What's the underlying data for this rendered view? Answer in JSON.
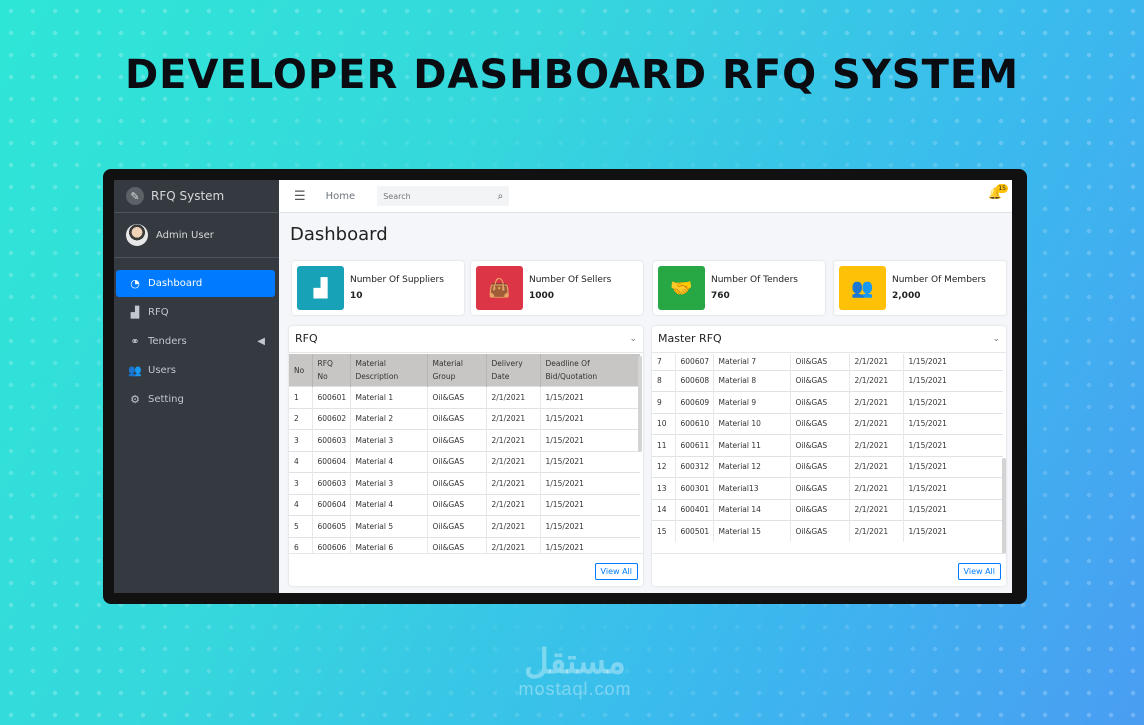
{
  "headline": "DEVELOPER DASHBOARD RFQ SYSTEM",
  "watermark": {
    "arabic": "مستقل",
    "latin": "mostaql.com"
  },
  "sidebar": {
    "brand": "RFQ System",
    "user": "Admin User",
    "items": [
      {
        "label": "Dashboard",
        "icon": "gauge-icon",
        "glyph": "◔"
      },
      {
        "label": "RFQ",
        "icon": "factory-icon",
        "glyph": "▟"
      },
      {
        "label": "Tenders",
        "icon": "handshake-icon",
        "glyph": "⚭"
      },
      {
        "label": "Users",
        "icon": "users-icon",
        "glyph": "👥"
      },
      {
        "label": "Setting",
        "icon": "gears-icon",
        "glyph": "⚙"
      }
    ]
  },
  "topbar": {
    "home": "Home",
    "search_placeholder": "Search",
    "notif_count": "15"
  },
  "page_title": "Dashboard",
  "stats": [
    {
      "label": "Number Of Suppliers",
      "value": "10",
      "color": "#17a2b8",
      "icon": "factory-icon",
      "glyph": "▟"
    },
    {
      "label": "Number Of Sellers",
      "value": "1000",
      "color": "#dc3545",
      "icon": "shopping-bag-icon",
      "glyph": "👜"
    },
    {
      "label": "Number Of Tenders",
      "value": "760",
      "color": "#28a745",
      "icon": "handshake-icon",
      "glyph": "🤝"
    },
    {
      "label": "Number Of Members",
      "value": "2,000",
      "color": "#ffc107",
      "icon": "users-icon",
      "glyph": "👥"
    }
  ],
  "rfq_card": {
    "title": "RFQ",
    "view_all": "View All",
    "headers": [
      "No",
      "RFQ No",
      "Material Description",
      "Material Group",
      "Delivery Date",
      "Deadline Of Bid/Quotation"
    ],
    "rows": [
      [
        "1",
        "600601",
        "Material 1",
        "Oil&GAS",
        "2/1/2021",
        "1/15/2021"
      ],
      [
        "2",
        "600602",
        "Material 2",
        "Oil&GAS",
        "2/1/2021",
        "1/15/2021"
      ],
      [
        "3",
        "600603",
        "Material 3",
        "Oil&GAS",
        "2/1/2021",
        "1/15/2021"
      ],
      [
        "4",
        "600604",
        "Material 4",
        "Oil&GAS",
        "2/1/2021",
        "1/15/2021"
      ],
      [
        "3",
        "600603",
        "Material 3",
        "Oil&GAS",
        "2/1/2021",
        "1/15/2021"
      ],
      [
        "4",
        "600604",
        "Material 4",
        "Oil&GAS",
        "2/1/2021",
        "1/15/2021"
      ],
      [
        "5",
        "600605",
        "Material 5",
        "Oil&GAS",
        "2/1/2021",
        "1/15/2021"
      ],
      [
        "6",
        "600606",
        "Material 6",
        "Oil&GAS",
        "2/1/2021",
        "1/15/2021"
      ]
    ]
  },
  "master_card": {
    "title": "Master RFQ",
    "view_all": "View All",
    "rows": [
      [
        "7",
        "600607",
        "Material 7",
        "Oil&GAS",
        "2/1/2021",
        "1/15/2021"
      ],
      [
        "8",
        "600608",
        "Material 8",
        "Oil&GAS",
        "2/1/2021",
        "1/15/2021"
      ],
      [
        "9",
        "600609",
        "Material 9",
        "Oil&GAS",
        "2/1/2021",
        "1/15/2021"
      ],
      [
        "10",
        "600610",
        "Material 10",
        "Oil&GAS",
        "2/1/2021",
        "1/15/2021"
      ],
      [
        "11",
        "600611",
        "Material 11",
        "Oil&GAS",
        "2/1/2021",
        "1/15/2021"
      ],
      [
        "12",
        "600312",
        "Material 12",
        "Oil&GAS",
        "2/1/2021",
        "1/15/2021"
      ],
      [
        "13",
        "600301",
        "Material13",
        "Oil&GAS",
        "2/1/2021",
        "1/15/2021"
      ],
      [
        "14",
        "600401",
        "Material 14",
        "Oil&GAS",
        "2/1/2021",
        "1/15/2021"
      ],
      [
        "15",
        "600501",
        "Material 15",
        "Oil&GAS",
        "2/1/2021",
        "1/15/2021"
      ]
    ]
  }
}
